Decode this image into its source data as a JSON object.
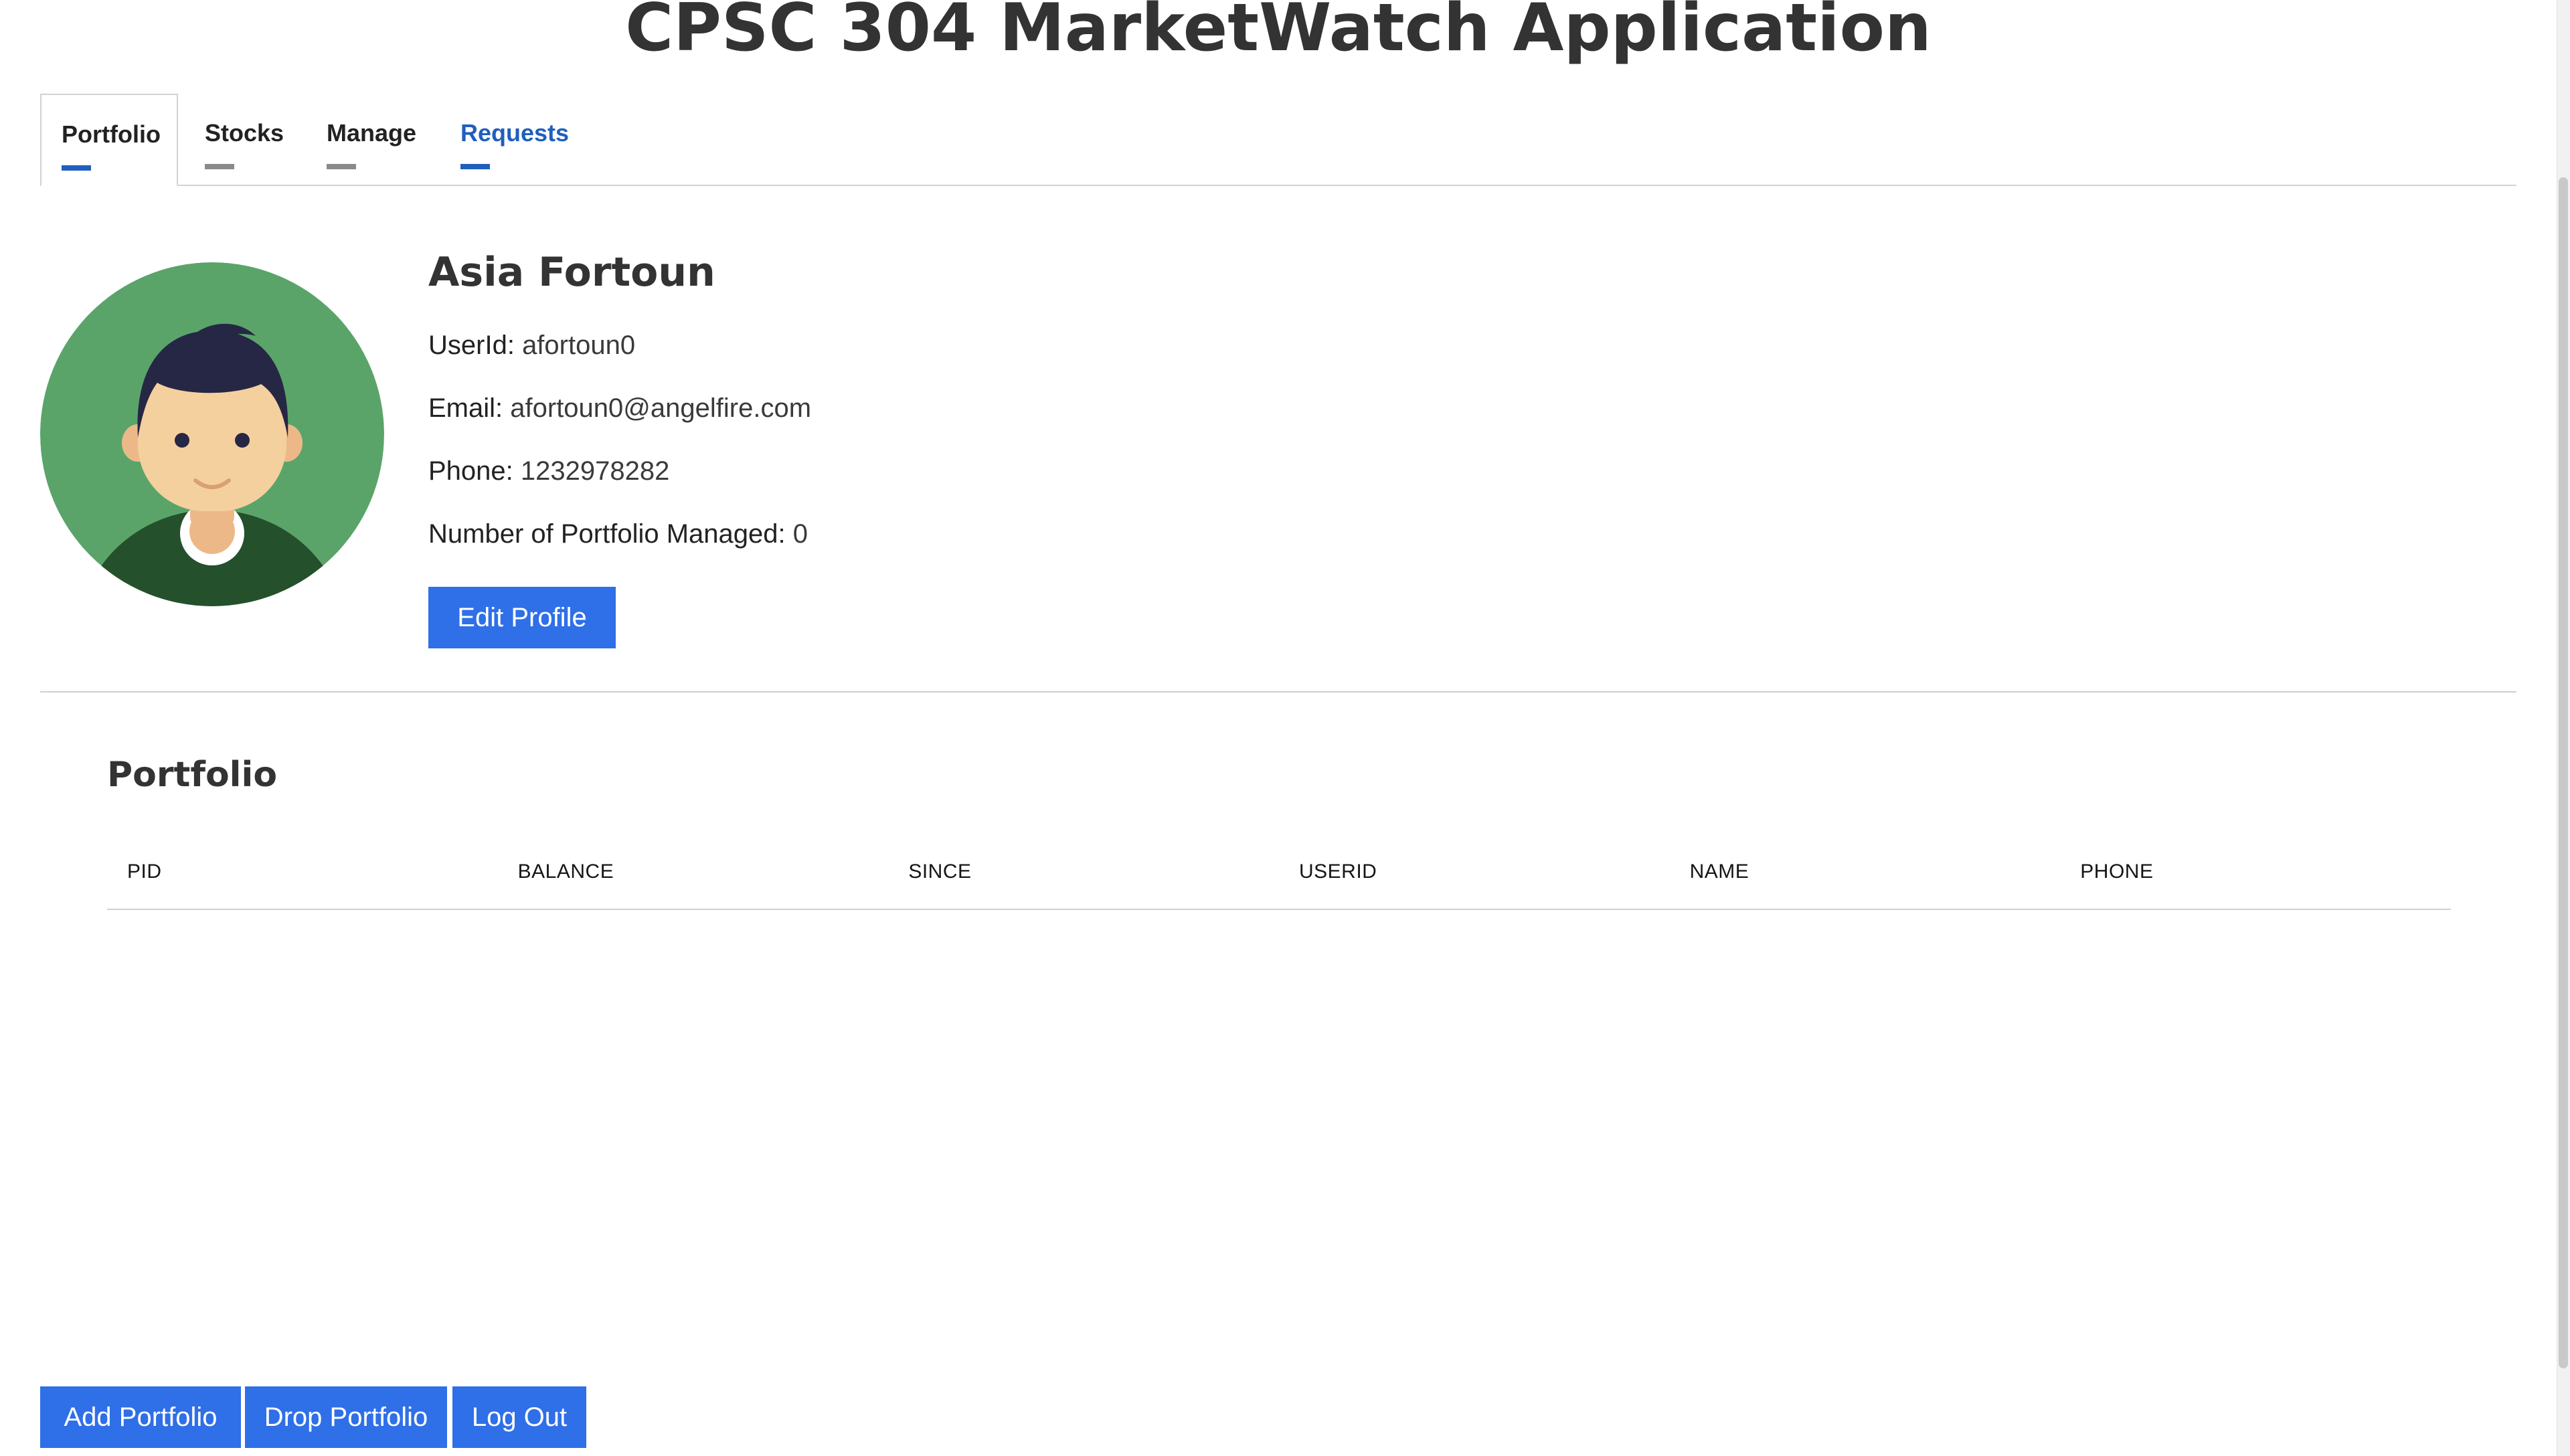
{
  "app": {
    "title": "CPSC 304 MarketWatch Application"
  },
  "tabs": [
    {
      "label": "Portfolio",
      "active": true
    },
    {
      "label": "Stocks",
      "active": false
    },
    {
      "label": "Manage",
      "active": false
    },
    {
      "label": "Requests",
      "active": false
    }
  ],
  "profile": {
    "name": "Asia Fortoun",
    "userid_label": "UserId:",
    "userid": "afortoun0",
    "email_label": "Email:",
    "email": "afortoun0@angelfire.com",
    "phone_label": "Phone:",
    "phone": "1232978282",
    "managed_label": "Number of Portfolio Managed:",
    "managed": "0",
    "edit_button": "Edit Profile",
    "avatar_icon": "user-avatar-icon"
  },
  "portfolio": {
    "heading": "Portfolio",
    "columns": [
      "PID",
      "BALANCE",
      "SINCE",
      "USERID",
      "NAME",
      "PHONE"
    ],
    "rows": []
  },
  "actions": {
    "add_portfolio": "Add Portfolio",
    "drop_portfolio": "Drop Portfolio",
    "log_out": "Log Out"
  },
  "colors": {
    "primary_button": "#2f6fe8",
    "active_tab_accent": "#1f5fbd",
    "inactive_tab_accent": "#8a8a8a",
    "avatar_bg": "#5aa46a"
  }
}
